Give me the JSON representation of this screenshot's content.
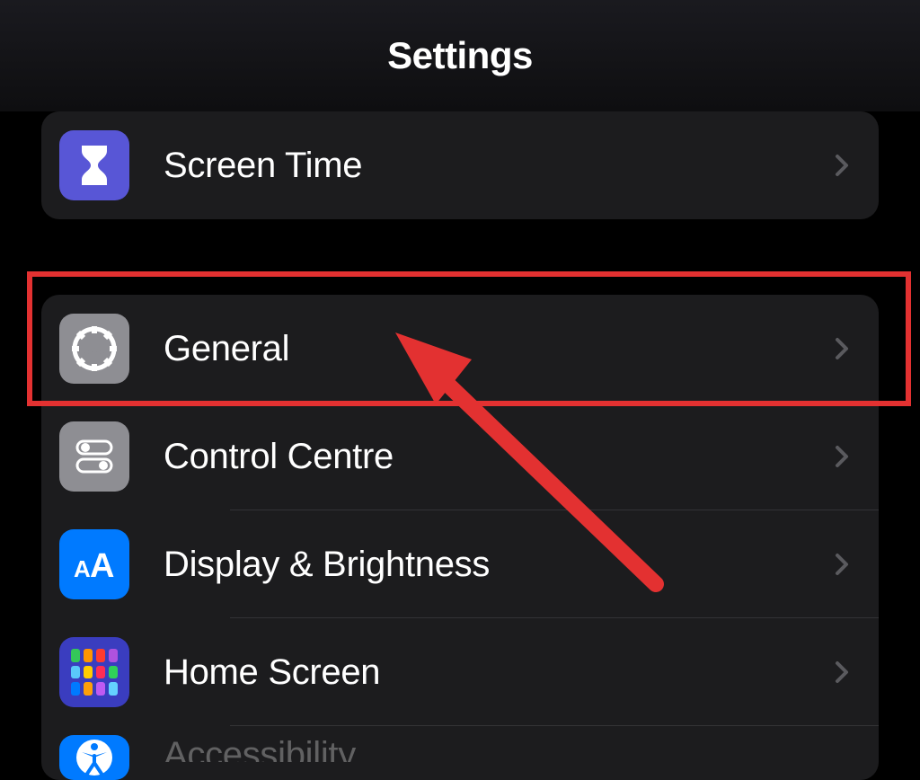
{
  "header": {
    "title": "Settings"
  },
  "group1": {
    "items": [
      {
        "label": "Screen Time"
      }
    ]
  },
  "group2": {
    "items": [
      {
        "label": "General"
      },
      {
        "label": "Control Centre"
      },
      {
        "label": "Display & Brightness"
      },
      {
        "label": "Home Screen"
      },
      {
        "label": "Accessibility"
      }
    ]
  },
  "annotation": {
    "highlight_target": "General",
    "highlight_color": "#e33131"
  }
}
